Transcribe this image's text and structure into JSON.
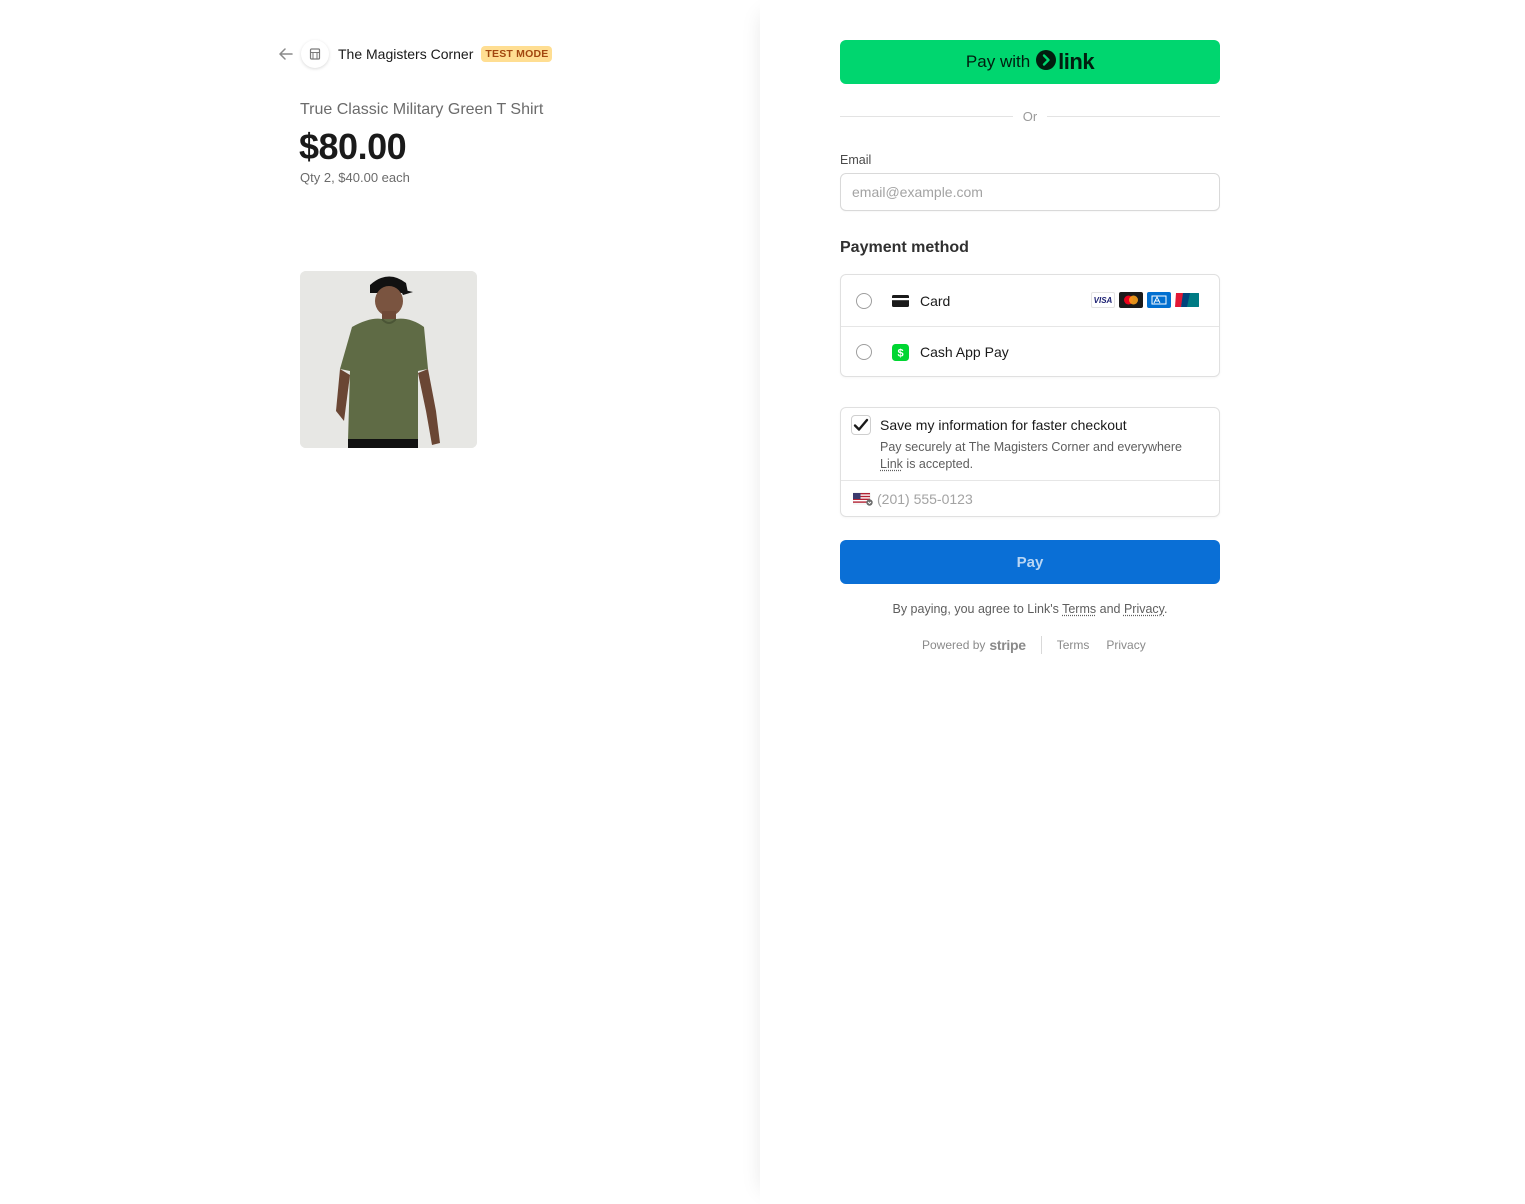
{
  "header": {
    "store_name": "The Magisters Corner",
    "test_badge": "TEST MODE"
  },
  "product": {
    "name": "True Classic Military Green T Shirt",
    "price": "$80.00",
    "qty_line": "Qty 2, $40.00 each"
  },
  "link_button": {
    "pay_with": "Pay with",
    "logo_word": "link"
  },
  "divider": {
    "or": "Or"
  },
  "email": {
    "label": "Email",
    "placeholder": "email@example.com",
    "value": ""
  },
  "payment_method": {
    "heading": "Payment method",
    "options": [
      {
        "label": "Card",
        "icon": "card-icon"
      },
      {
        "label": "Cash App Pay",
        "icon": "cash-app-icon"
      }
    ],
    "card_brands": [
      "visa",
      "mastercard",
      "amex",
      "unionpay"
    ]
  },
  "save_info": {
    "checked": true,
    "title": "Save my information for faster checkout",
    "desc_prefix": "Pay securely at The Magisters Corner and everywhere ",
    "desc_link": "Link",
    "desc_suffix": " is accepted.",
    "phone_placeholder": "(201) 555-0123"
  },
  "pay_button": {
    "label": "Pay"
  },
  "agreement": {
    "prefix": "By paying, you agree to Link's ",
    "terms": "Terms",
    "and": " and ",
    "privacy": "Privacy",
    "suffix": "."
  },
  "footer": {
    "powered_by": "Powered by",
    "stripe": "stripe",
    "terms": "Terms",
    "privacy": "Privacy"
  },
  "colors": {
    "link_green": "#00d66f",
    "pay_blue": "#0a6fd6",
    "test_badge_bg": "#ffde92",
    "test_badge_text": "#a2470f",
    "shirt_green": "#5f6b45"
  }
}
